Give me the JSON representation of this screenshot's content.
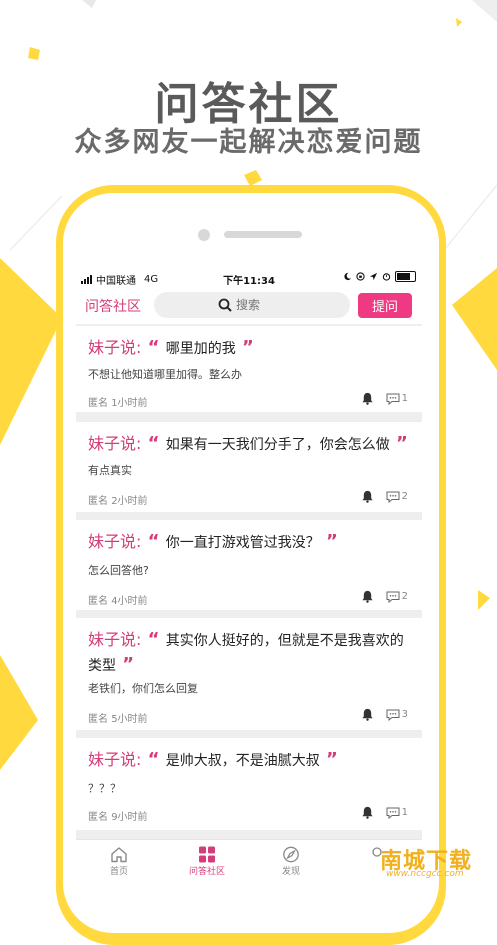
{
  "promo": {
    "title": "问答社区",
    "subtitle": "众多网友一起解决恋爱问题"
  },
  "status": {
    "carrier": "中国联通",
    "network": "4G",
    "time": "下午11:34"
  },
  "header": {
    "title": "问答社区",
    "search_placeholder": "搜索",
    "ask_label": "提问"
  },
  "questions": [
    {
      "prefix": "妹子说:",
      "title": "哪里加的我",
      "desc": "不想让他知道哪里加得。整么办",
      "author": "匿名",
      "time": "1小时前",
      "comments": "1"
    },
    {
      "prefix": "妹子说:",
      "title": "如果有一天我们分手了，你会怎么做",
      "desc": "有点真实",
      "author": "匿名",
      "time": "2小时前",
      "comments": "2"
    },
    {
      "prefix": "妹子说:",
      "title": "你一直打游戏管过我没？",
      "desc": "怎么回答他?",
      "author": "匿名",
      "time": "4小时前",
      "comments": "2"
    },
    {
      "prefix": "妹子说:",
      "title": "其实你人挺好的，但就是不是我喜欢的类型",
      "desc": "老铁们，你们怎么回复",
      "author": "匿名",
      "time": "5小时前",
      "comments": "3"
    },
    {
      "prefix": "妹子说:",
      "title": "是帅大叔，不是油腻大叔",
      "desc": "？？？",
      "author": "匿名",
      "time": "9小时前",
      "comments": "1"
    }
  ],
  "tabs": [
    {
      "label": "首页",
      "icon": "home-icon"
    },
    {
      "label": "问答社区",
      "icon": "grid-icon"
    },
    {
      "label": "发现",
      "icon": "compass-icon"
    }
  ],
  "watermark": {
    "text": "南城下载",
    "sub": "www.nccgcc.com"
  },
  "colors": {
    "accent": "#d43d7a",
    "button": "#ef3a83",
    "phone_frame": "#ffd93d"
  }
}
